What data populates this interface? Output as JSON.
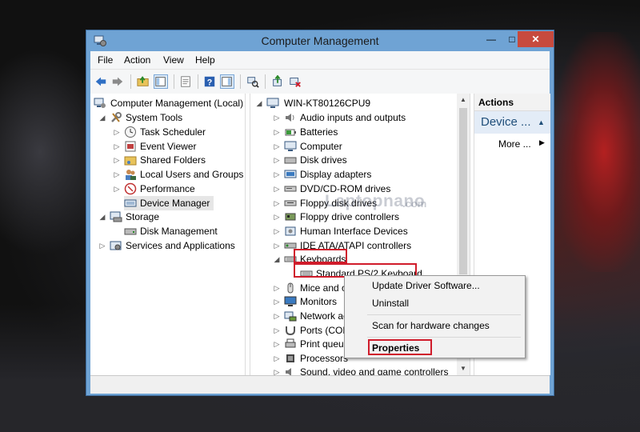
{
  "window": {
    "title": "Computer Management"
  },
  "menubar": {
    "items": [
      "File",
      "Action",
      "View",
      "Help"
    ]
  },
  "left_tree": {
    "items": [
      {
        "label": "Computer Management (Local)"
      },
      {
        "label": "System Tools"
      },
      {
        "label": "Task Scheduler"
      },
      {
        "label": "Event Viewer"
      },
      {
        "label": "Shared Folders"
      },
      {
        "label": "Local Users and Groups"
      },
      {
        "label": "Performance"
      },
      {
        "label": "Device Manager"
      },
      {
        "label": "Storage"
      },
      {
        "label": "Disk Management"
      },
      {
        "label": "Services and Applications"
      }
    ]
  },
  "device_tree": {
    "root": "WIN-KT80126CPU9",
    "items": [
      {
        "label": "Audio inputs and outputs"
      },
      {
        "label": "Batteries"
      },
      {
        "label": "Computer"
      },
      {
        "label": "Disk drives"
      },
      {
        "label": "Display adapters"
      },
      {
        "label": "DVD/CD-ROM drives"
      },
      {
        "label": "Floppy disk drives"
      },
      {
        "label": "Floppy drive controllers"
      },
      {
        "label": "Human Interface Devices"
      },
      {
        "label": "IDE ATA/ATAPI controllers"
      },
      {
        "label": "Keyboards"
      },
      {
        "label": "Standard PS/2 Keyboard"
      },
      {
        "label": "Mice and o"
      },
      {
        "label": "Monitors"
      },
      {
        "label": "Network ac"
      },
      {
        "label": "Ports (COM"
      },
      {
        "label": "Print queue"
      },
      {
        "label": "Processors"
      },
      {
        "label": "Sound, video and game controllers"
      }
    ]
  },
  "actions": {
    "header": "Actions",
    "section": "Device ...",
    "more": "More ..."
  },
  "context_menu": {
    "items": [
      "Update Driver Software...",
      "Uninstall",
      "Scan for hardware changes",
      "Properties"
    ]
  },
  "watermark": {
    "text": "Laptopnano",
    "suffix": ".com"
  },
  "colors": {
    "highlight_box": "#d01c2b",
    "title_bar": "#6fa3d4",
    "close_button": "#c74a3e"
  }
}
